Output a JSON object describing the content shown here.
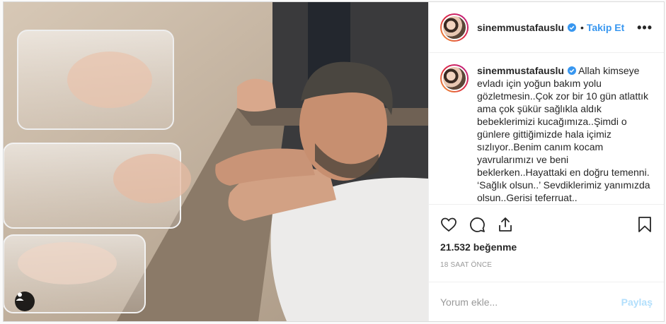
{
  "post": {
    "photo": {
      "user_tag_icon": "user-silhouette-icon"
    },
    "header": {
      "username": "sinemmustafauslu",
      "verified_icon": "verified-badge-icon",
      "dot": "•",
      "follow_label": "Takip Et",
      "more_icon": "more-options-icon",
      "more_label": "•••"
    },
    "caption": {
      "username": "sinemmustafauslu",
      "text": "Allah kimseye evladı için yoğun bakım yolu gözletmesin..Çok zor bir 10 gün atlattık ama çok şükür sağlıkla aldık bebeklerimizi kucağımıza..Şimdi o günlere gittiğimizde hala içimiz sızlıyor..Benim canım kocam yavrularımızı ve beni beklerken..Hayattaki en doğru temenni. ‘Sağlık olsun..’ Sevdiklerimiz yanımızda olsun..Gerisi teferruat.."
    },
    "actions": {
      "like_icon": "heart-icon",
      "comment_icon": "comment-bubble-icon",
      "share_icon": "share-icon",
      "save_icon": "bookmark-icon",
      "likes": "21.532 beğenme",
      "time": "18 SAAT ÖNCE"
    },
    "comment_box": {
      "placeholder": "Yorum ekle...",
      "post_label": "Paylaş"
    },
    "colors": {
      "link_blue": "#3897f0",
      "post_disabled": "#b2dffc",
      "muted": "#999999",
      "text": "#262626",
      "border": "#dbdbdb"
    }
  }
}
